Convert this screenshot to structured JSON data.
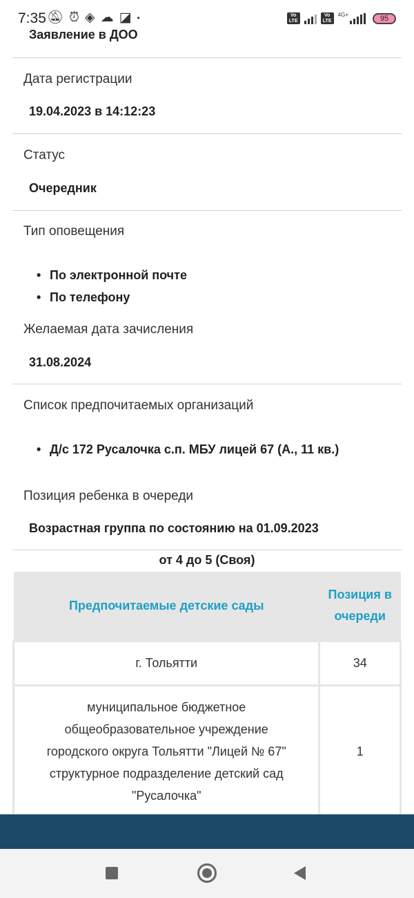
{
  "status_bar": {
    "time": "7:35",
    "battery": "95",
    "network": "4G+",
    "volte_label": "Vo LTE"
  },
  "header": {
    "title": "Заявление в ДОО"
  },
  "fields": {
    "registration_date_label": "Дата регистрации",
    "registration_date_value": "19.04.2023 в 14:12:23",
    "status_label": "Статус",
    "status_value": "Очередник",
    "notification_type_label": "Тип оповещения",
    "notification_types": [
      "По электронной почте",
      "По телефону"
    ],
    "desired_date_label": "Желаемая дата зачисления",
    "desired_date_value": "31.08.2024",
    "preferred_orgs_label": "Список предпочитаемых организаций",
    "preferred_orgs": [
      "Д/с 172 Русалочка с.п. МБУ лицей 67 (А., 11 кв.)"
    ],
    "queue_position_label": "Позиция ребенка в очереди",
    "age_group_heading": "Возрастная группа по состоянию на 01.09.2023"
  },
  "queue_table": {
    "group": "от 4 до 5 (Своя)",
    "headers": {
      "kindergartens": "Предпочитаемые детские сады",
      "position": "Позиция в очереди"
    },
    "rows": [
      {
        "name": "г. Тольятти",
        "position": "34"
      },
      {
        "name": "муниципальное бюджетное общеобразовательное учреждение городского округа Тольятти \"Лицей № 67\" структурное подразделение детский сад \"Русалочка\"",
        "position": "1"
      }
    ]
  },
  "colors": {
    "accent": "#1e9fc6",
    "bottom_bar": "#1d4a68",
    "table_header_bg": "#e6e6e6"
  }
}
